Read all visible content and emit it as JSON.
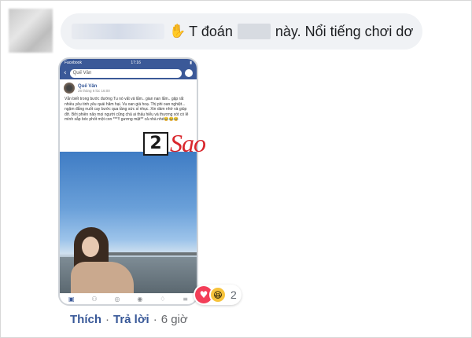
{
  "comment": {
    "text_before_blur": "T đoán",
    "text_after_blur": "này. Nổi tiếng chơi dơ",
    "hand_icon": "wave-hand-icon"
  },
  "phone": {
    "status_left": "Facebook",
    "status_time": "17:16",
    "search_value": "Quế Vân",
    "post_author": "Quế Vân",
    "post_time": "25 tháng 6 lúc 16:00",
    "post_text": "Vẫn biết trong bước đường Tu nó vất vả lắm.. gian nan lắm.. gặp rất nhiều yêu tinh yêu quái hãm hại. Vu oan giá hoạ. Thị phi oan nghiệt... ngậm đắng nuốt cay bước qua tầng sức sỉ nhục. Xin dám nhờ và giúp đỡ. Bởi phiền não mọi người cũng chả ai thấu hiểu và thương xót có lẽ mình sắp bóc phốt một con ***!! gương mặt** cả nhà nhé😂😂😂"
  },
  "watermark": {
    "number": "2",
    "brand": "Sao"
  },
  "reactions": {
    "count": "2",
    "icons": [
      "heart-icon",
      "haha-icon"
    ]
  },
  "actions": {
    "like_label": "Thích",
    "reply_label": "Trả lời",
    "time_label": "6 giờ",
    "separator": "·"
  }
}
